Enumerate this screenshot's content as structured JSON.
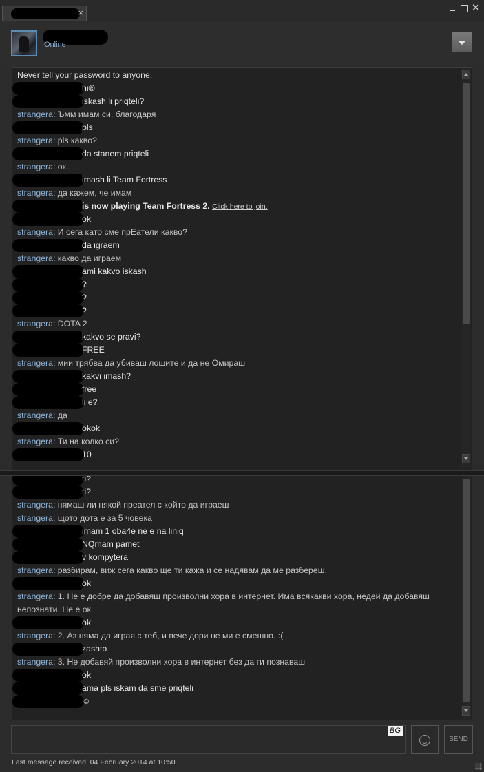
{
  "window": {
    "tab_close": "×",
    "minimize_icon": "minimize-icon",
    "maximize_icon": "maximize-icon",
    "close_label": "✕"
  },
  "header": {
    "status": "Online"
  },
  "chat": {
    "notice": "Never tell your password to anyone.",
    "messages": [
      {
        "from": "me",
        "text": "hi®"
      },
      {
        "from": "me",
        "text": "iskash li priqteli?"
      },
      {
        "from": "them",
        "sender": "strangera",
        "text": "Ъмм имам си, благодаря"
      },
      {
        "from": "me",
        "text": "pls"
      },
      {
        "from": "them",
        "sender": "strangera",
        "text": "pls какво?"
      },
      {
        "from": "me",
        "text": "da stanem priqteli"
      },
      {
        "from": "them",
        "sender": "strangera",
        "text": "ок..."
      },
      {
        "from": "me",
        "text": "imash li Team Fortress"
      },
      {
        "from": "them",
        "sender": "strangera",
        "text": "да кажем, че имам"
      },
      {
        "from": "system",
        "text": "is now playing Team Fortress 2.",
        "link": "Click here to join."
      },
      {
        "from": "me",
        "text": "ok"
      },
      {
        "from": "them",
        "sender": "strangera",
        "text": "И сега като сме прЕатели какво?"
      },
      {
        "from": "me",
        "text": "da igraem"
      },
      {
        "from": "them",
        "sender": "strangera",
        "text": "какво да играем"
      },
      {
        "from": "me",
        "text": "ami kakvo iskash"
      },
      {
        "from": "me",
        "text": "?"
      },
      {
        "from": "me",
        "text": "?"
      },
      {
        "from": "me",
        "text": "?"
      },
      {
        "from": "them",
        "sender": "strangera",
        "text": "DOTA 2"
      },
      {
        "from": "me",
        "text": "kakvo se pravi?"
      },
      {
        "from": "me",
        "text": "FREE"
      },
      {
        "from": "them",
        "sender": "strangera",
        "text": "мии трябва да убиваш лошите и да не Омираш"
      },
      {
        "from": "me",
        "text": "kakvi imash?"
      },
      {
        "from": "me",
        "text": "free"
      },
      {
        "from": "me",
        "text": "li e?"
      },
      {
        "from": "them",
        "sender": "strangera",
        "text": "да"
      },
      {
        "from": "me",
        "text": "okok"
      },
      {
        "from": "them",
        "sender": "strangera",
        "text": "Ти на колко си?"
      },
      {
        "from": "me",
        "text": "10"
      },
      {
        "from": "me",
        "text": "ti?"
      },
      {
        "from": "me",
        "text": "ti?"
      },
      {
        "from": "them",
        "sender": "strangera",
        "text": "нямаш ли някой преател с който да играеш"
      },
      {
        "from": "them",
        "sender": "strangera",
        "text": "щото дота е за 5 човека"
      },
      {
        "from": "me",
        "text": "imam 1 oba4e ne e na liniq"
      },
      {
        "from": "me",
        "text": "NQmam pamet"
      },
      {
        "from": "me",
        "text": "v kompytera"
      },
      {
        "from": "them",
        "sender": "strangera",
        "text": "разбирам, виж сега какво ще ти кажа и се надявам да ме разбереш."
      },
      {
        "from": "me",
        "text": "ok"
      },
      {
        "from": "them",
        "sender": "strangera",
        "text": "1. Не е добре да добавяш произволни хора в интернет. Има всякакви хора, недей да добавяш непознати. Не е ок."
      },
      {
        "from": "me",
        "text": "ok"
      },
      {
        "from": "them",
        "sender": "strangera",
        "text": "2. Аз няма да играя с теб, и вече дори не ми е смешно. :("
      },
      {
        "from": "me",
        "text": "zashto"
      },
      {
        "from": "them",
        "sender": "strangera",
        "text": "3. Не добавяй произволни хора в интернет без да ги познаваш"
      },
      {
        "from": "me",
        "text": "ok"
      },
      {
        "from": "me",
        "text": "ama pls iskam da sme priqteli"
      },
      {
        "from": "me",
        "text": "☺"
      }
    ]
  },
  "composer": {
    "language": "BG",
    "emoticon_icon": "smiley-face-icon",
    "send_label": "SEND"
  },
  "footer": {
    "last_message": "Last message received: 04 February 2014 at 10:50"
  }
}
